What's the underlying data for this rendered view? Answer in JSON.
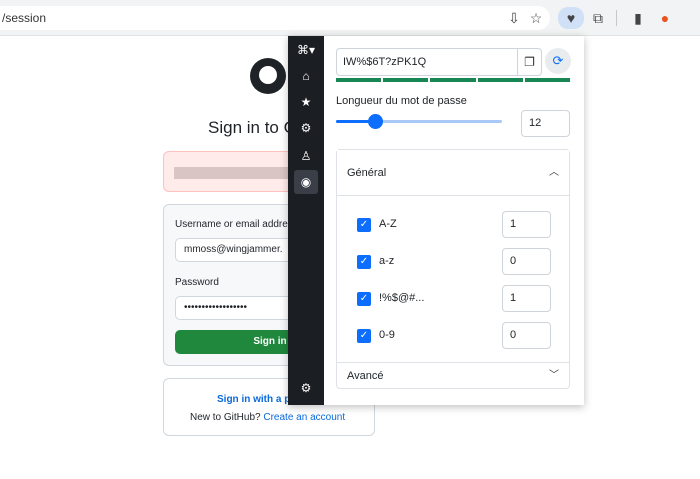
{
  "browser": {
    "url_fragment": "/session",
    "extension_color": "#cfe0f7"
  },
  "github": {
    "title_partial": "Sign in to G",
    "username_label": "Username or email address",
    "username_value": "mmoss@wingjammer.",
    "password_label": "Password",
    "password_value": "••••••••••••••••••",
    "signin_label": "Sign in",
    "passkey_label": "Sign in with a p",
    "new_text": "New to GitHub?",
    "create_account": "Create an account"
  },
  "popup": {
    "password": "IW%$6T?zPK1Q",
    "length_label": "Longueur du mot de passe",
    "length_value": "12",
    "length_fraction": 0.24,
    "strength_segments": 5,
    "general_label": "Général",
    "advanced_label": "Avancé",
    "options": [
      {
        "label": "A-Z",
        "value": "1",
        "checked": true
      },
      {
        "label": "a-z",
        "value": "0",
        "checked": true
      },
      {
        "label": "!%$@#...",
        "value": "1",
        "checked": true
      },
      {
        "label": "0-9",
        "value": "0",
        "checked": true
      }
    ],
    "accent_color": "#0d6efd",
    "strength_color": "#198754"
  }
}
